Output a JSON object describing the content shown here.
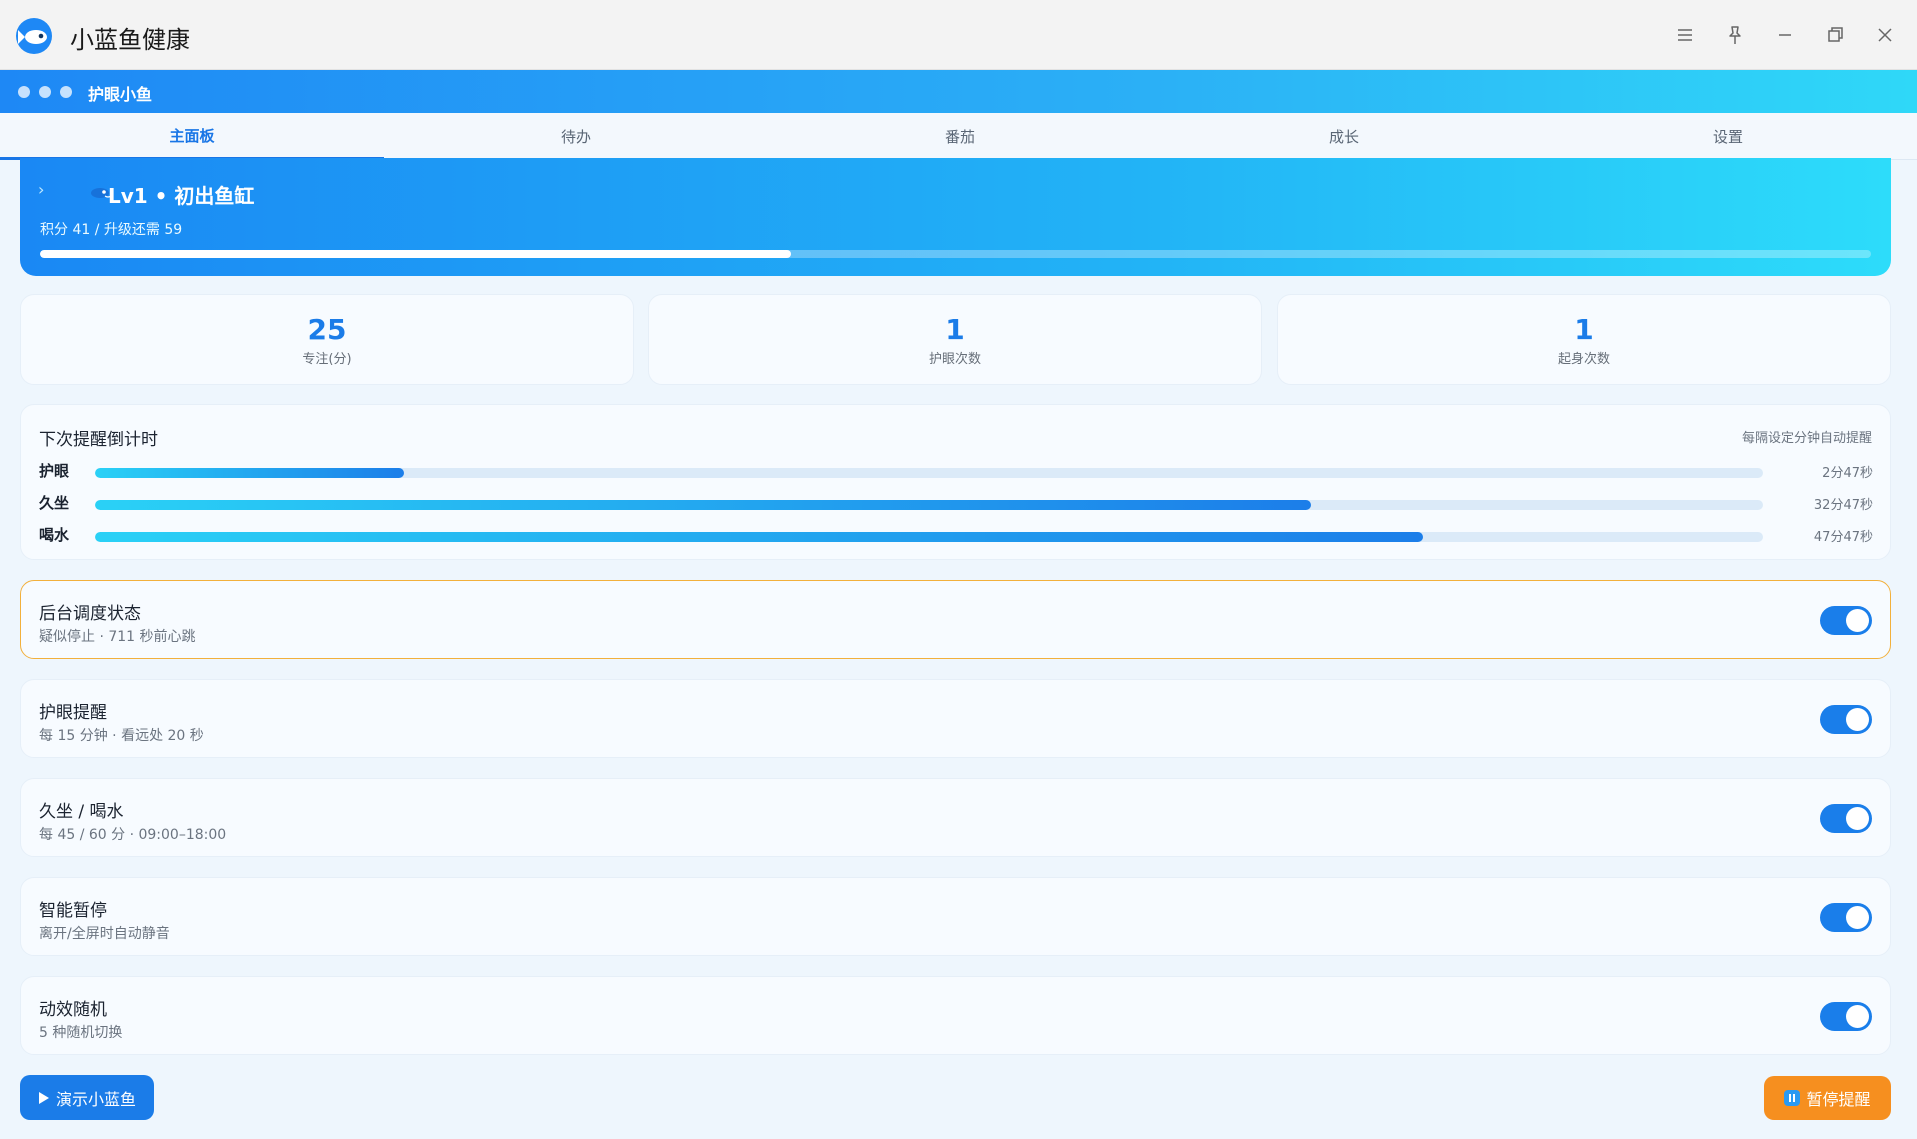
{
  "window": {
    "title": "小蓝鱼健康",
    "controls": [
      "menu-icon",
      "pin-icon",
      "minimize-icon",
      "restore-icon",
      "close-icon"
    ]
  },
  "header_bar": {
    "title": "护眼小鱼"
  },
  "tabs": [
    {
      "label": "主面板",
      "active": true
    },
    {
      "label": "待办",
      "active": false
    },
    {
      "label": "番茄",
      "active": false
    },
    {
      "label": "成长",
      "active": false
    },
    {
      "label": "设置",
      "active": false
    }
  ],
  "level": {
    "title": "Lv1 • 初出鱼缸",
    "points_text": "积分 41 / 升级还需 59",
    "progress": 0.41
  },
  "stats": [
    {
      "value": "25",
      "label": "专注(分)"
    },
    {
      "value": "1",
      "label": "护眼次数"
    },
    {
      "value": "1",
      "label": "起身次数"
    }
  ],
  "countdown": {
    "title": "下次提醒倒计时",
    "note": "每隔设定分钟自动提醒",
    "rows": [
      {
        "label": "护眼",
        "time": "2分47秒",
        "fraction": 0.185
      },
      {
        "label": "久坐",
        "time": "32分47秒",
        "fraction": 0.729
      },
      {
        "label": "喝水",
        "time": "47分47秒",
        "fraction": 0.796
      }
    ]
  },
  "toggles": [
    {
      "title": "后台调度状态",
      "subtitle": "疑似停止 · 711 秒前心跳",
      "on": true,
      "warning": true
    },
    {
      "title": "护眼提醒",
      "subtitle": "每 15 分钟 · 看远处 20 秒",
      "on": true,
      "warning": false
    },
    {
      "title": "久坐 / 喝水",
      "subtitle": "每 45 / 60 分 · 09:00–18:00",
      "on": true,
      "warning": false
    },
    {
      "title": "智能暂停",
      "subtitle": "离开/全屏时自动静音",
      "on": true,
      "warning": false
    },
    {
      "title": "动效随机",
      "subtitle": "5 种随机切换",
      "on": true,
      "warning": false
    }
  ],
  "footer": {
    "demo_button": "演示小蓝鱼",
    "pause_button": "暂停提醒"
  },
  "colors": {
    "accent": "#1b7ce8",
    "warning_border": "#f2b03c",
    "pause_button": "#f68f1f"
  }
}
